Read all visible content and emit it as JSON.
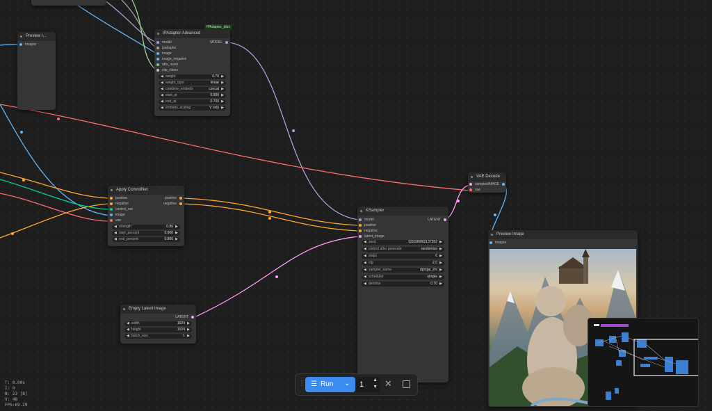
{
  "colors": {
    "link_model": "#b39ddb",
    "link_image": "#64b5f6",
    "link_vae": "#ff6e6e",
    "link_conditioning": "#ffa931",
    "link_latent": "#ff9cf9",
    "link_clip_vision": "#a1d99b",
    "link_control_net": "#00d78d",
    "run_button": "#3a8cf0"
  },
  "nodes": {
    "preview_small": {
      "title": "Preview I...",
      "inputs": [
        "images"
      ]
    },
    "ipadapter": {
      "badge": "IPAdapter_plus",
      "title": "IPAdapter Advanced",
      "inputs": [
        "model",
        "ipadapter",
        "image",
        "image_negative",
        "attn_mask",
        "clip_vision"
      ],
      "output": "MODEL",
      "widgets": [
        {
          "label": "weight",
          "value": "0.70"
        },
        {
          "label": "weight_type",
          "value": "linear"
        },
        {
          "label": "combine_embeds",
          "value": "concat"
        },
        {
          "label": "start_at",
          "value": "0.000"
        },
        {
          "label": "end_at",
          "value": "0.700"
        },
        {
          "label": "embeds_scaling",
          "value": "V only"
        }
      ]
    },
    "controlnet": {
      "title": "Apply ControlNet",
      "inputs": [
        "positive",
        "negative",
        "control_net",
        "image",
        "vae"
      ],
      "outputs": [
        "positive",
        "negative"
      ],
      "widgets": [
        {
          "label": "strength",
          "value": "0.86"
        },
        {
          "label": "start_percent",
          "value": "0.000"
        },
        {
          "label": "end_percent",
          "value": "0.800"
        }
      ]
    },
    "ksampler": {
      "title": "KSampler",
      "inputs": [
        "model",
        "positive",
        "negative",
        "latent_image"
      ],
      "output": "LATENT",
      "widgets": [
        {
          "label": "seed",
          "value": "939186802137552"
        },
        {
          "label": "control after generate",
          "value": "randomize"
        },
        {
          "label": "steps",
          "value": "6"
        },
        {
          "label": "cfg",
          "value": "2.0"
        },
        {
          "label": "sampler_name",
          "value": "dpmpp_2m"
        },
        {
          "label": "scheduler",
          "value": "simple"
        },
        {
          "label": "denoise",
          "value": "0.70"
        }
      ]
    },
    "vae_decode": {
      "title": "VAE Decode",
      "inputs": [
        "samples",
        "vae"
      ],
      "output": "IMAGE"
    },
    "preview_image": {
      "title": "Preview Image",
      "inputs": [
        "images"
      ]
    },
    "empty_latent": {
      "title": "Empty Latent Image",
      "output": "LATENT",
      "widgets": [
        {
          "label": "width",
          "value": "1024"
        },
        {
          "label": "height",
          "value": "1024"
        },
        {
          "label": "batch_size",
          "value": "1"
        }
      ]
    }
  },
  "runbar": {
    "run_label": "Run",
    "queue_count": "1"
  },
  "stats": {
    "t": "T: 0.00s",
    "i": "I: 0",
    "n": "N: 23 [8]",
    "v": "V: 48",
    "fps": "FPS:69.29"
  },
  "icons": {
    "drag": "drag-handle-icon",
    "queue": "queue-icon",
    "dropdown": "chevron-down-icon",
    "cancel": "close-icon",
    "stop": "stop-icon"
  }
}
